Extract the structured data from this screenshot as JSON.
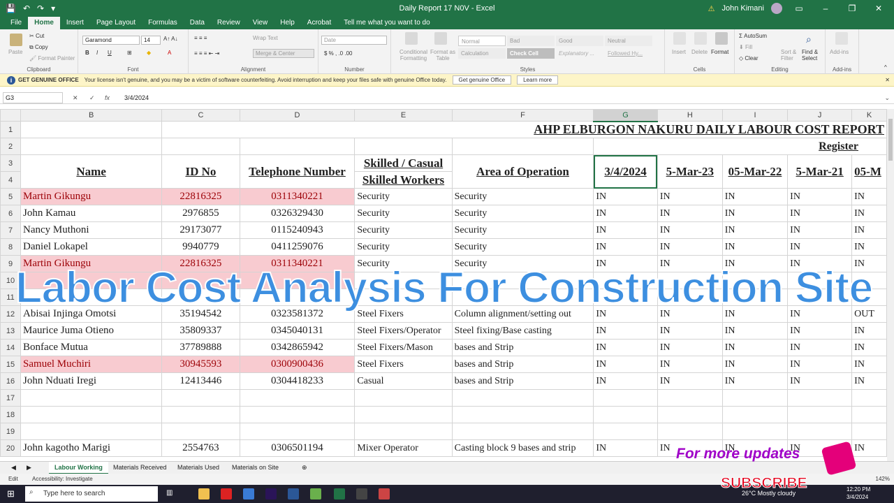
{
  "titlebar": {
    "title": "Daily Report 17 N0V  -  Excel",
    "user": "John Kimani",
    "autosave_icon": "save-icon",
    "warning_icon": "warning-icon"
  },
  "tabs": [
    "File",
    "Home",
    "Insert",
    "Page Layout",
    "Formulas",
    "Data",
    "Review",
    "View",
    "Help",
    "Acrobat",
    "Tell me what you want to do"
  ],
  "active_tab": "Home",
  "ribbon": {
    "clipboard": {
      "label": "Clipboard",
      "paste": "Paste",
      "cut": "Cut",
      "copy": "Copy",
      "format_painter": "Format Painter"
    },
    "font": {
      "label": "Font",
      "family": "Garamond",
      "size": "14",
      "bold": "B",
      "italic": "I",
      "underline": "U"
    },
    "alignment": {
      "label": "Alignment",
      "wrap": "Wrap Text",
      "merge": "Merge & Center"
    },
    "number": {
      "label": "Number",
      "format": "Date"
    },
    "styles": {
      "label": "Styles",
      "conditional": "Conditional Formatting",
      "format_table": "Format as Table",
      "cells": [
        "Normal",
        "Bad",
        "Good",
        "Neutral",
        "Calculation",
        "Check Cell",
        "Explanatory ...",
        "Followed Hy..."
      ]
    },
    "cells": {
      "label": "Cells",
      "insert": "Insert",
      "delete": "Delete",
      "format": "Format"
    },
    "editing": {
      "label": "Editing",
      "autosum": "AutoSum",
      "fill": "Fill",
      "clear": "Clear",
      "sort": "Sort & Filter",
      "find": "Find & Select"
    },
    "addins": {
      "label": "Add-ins",
      "addins": "Add-ins"
    }
  },
  "notice": {
    "title": "GET GENUINE OFFICE",
    "text": "Your license isn't genuine, and you may be a victim of software counterfeiting. Avoid interruption and keep your files safe with genuine Office today.",
    "button1": "Get genuine Office",
    "button2": "Learn more"
  },
  "formula_bar": {
    "cell": "G3",
    "cancel": "✕",
    "enter": "✓",
    "fx": "fx",
    "value": "3/4/2024"
  },
  "columns": [
    "B",
    "C",
    "D",
    "E",
    "F",
    "G",
    "H",
    "I",
    "J",
    "K"
  ],
  "row_numbers": [
    "1",
    "2",
    "3",
    "4",
    "5",
    "6",
    "7",
    "8",
    "9",
    "10",
    "11",
    "12",
    "13",
    "14",
    "15",
    "16",
    "17",
    "18",
    "19",
    "20"
  ],
  "sheet": {
    "title": "AHP ELBURGON NAKURU DAILY LABOUR COST REPORT",
    "register": "Register",
    "headers": {
      "name": "Name",
      "id": "ID No",
      "phone": "Telephone Number",
      "skill1": "Skilled / Casual",
      "skill2": "Skilled Workers",
      "area": "Area of Operation",
      "d1": "3/4/2024",
      "d2": "5-Mar-23",
      "d3": "05-Mar-22",
      "d4": "5-Mar-21",
      "d5": "05-M"
    },
    "rows": [
      {
        "n": "5",
        "name": "Martin Gikungu",
        "id": "22816325",
        "phone": "0311340221",
        "skill": "Security",
        "area": "Security",
        "g": "IN",
        "h": "IN",
        "i": "IN",
        "j": "IN",
        "k": "IN",
        "pink": true
      },
      {
        "n": "6",
        "name": "John Kamau",
        "id": "2976855",
        "phone": "0326329430",
        "skill": "Security",
        "area": "Security",
        "g": "IN",
        "h": "IN",
        "i": "IN",
        "j": "IN",
        "k": "IN",
        "pink": false
      },
      {
        "n": "7",
        "name": "Nancy Muthoni",
        "id": "29173077",
        "phone": "0115240943",
        "skill": "Security",
        "area": "Security",
        "g": "IN",
        "h": "IN",
        "i": "IN",
        "j": "IN",
        "k": "IN",
        "pink": false
      },
      {
        "n": "8",
        "name": "Daniel Lokapel",
        "id": "9940779",
        "phone": "0411259076",
        "skill": "Security",
        "area": "Security",
        "g": "IN",
        "h": "IN",
        "i": "IN",
        "j": "IN",
        "k": "IN",
        "pink": false
      },
      {
        "n": "9",
        "name": "Martin Gikungu",
        "id": "22816325",
        "phone": "0311340221",
        "skill": "Security",
        "area": "Security",
        "g": "IN",
        "h": "IN",
        "i": "IN",
        "j": "IN",
        "k": "IN",
        "pink": true
      },
      {
        "n": "10",
        "name": "",
        "id": "",
        "phone": "",
        "skill": "",
        "area": "",
        "g": "",
        "h": "",
        "i": "",
        "j": "",
        "k": "",
        "pink": true
      },
      {
        "n": "11",
        "name": "",
        "id": "",
        "phone": "",
        "skill": "",
        "area": "",
        "g": "",
        "h": "",
        "i": "",
        "j": "",
        "k": "",
        "pink": false
      },
      {
        "n": "12",
        "name": "Abisai Injinga Omotsi",
        "id": "35194542",
        "phone": "0323581372",
        "skill": "Steel Fixers",
        "area": "Column alignment/setting out",
        "g": "IN",
        "h": "IN",
        "i": "IN",
        "j": "IN",
        "k": "OUT",
        "pink": false
      },
      {
        "n": "13",
        "name": "Maurice Juma Otieno",
        "id": "35809337",
        "phone": "0345040131",
        "skill": "Steel Fixers/Operator",
        "area": "Steel fixing/Base casting",
        "g": "IN",
        "h": "IN",
        "i": "IN",
        "j": "IN",
        "k": "IN",
        "pink": false
      },
      {
        "n": "14",
        "name": "Bonface Mutua",
        "id": "37789888",
        "phone": "0342865942",
        "skill": "Steel Fixers/Mason",
        "area": "bases and Strip",
        "g": "IN",
        "h": "IN",
        "i": "IN",
        "j": "IN",
        "k": "IN",
        "pink": false
      },
      {
        "n": "15",
        "name": "Samuel Muchiri",
        "id": "30945593",
        "phone": "0300900436",
        "skill": "Steel Fixers",
        "area": "bases and Strip",
        "g": "IN",
        "h": "IN",
        "i": "IN",
        "j": "IN",
        "k": "IN",
        "pink": true
      },
      {
        "n": "16",
        "name": "John Nduati Iregi",
        "id": "12413446",
        "phone": "0304418233",
        "skill": "Casual",
        "area": "bases and Strip",
        "g": "IN",
        "h": "IN",
        "i": "IN",
        "j": "IN",
        "k": "IN",
        "pink": false
      },
      {
        "n": "17",
        "name": "",
        "id": "",
        "phone": "",
        "skill": "",
        "area": "",
        "g": "",
        "h": "",
        "i": "",
        "j": "",
        "k": "",
        "pink": false
      },
      {
        "n": "18",
        "name": "",
        "id": "",
        "phone": "",
        "skill": "",
        "area": "",
        "g": "",
        "h": "",
        "i": "",
        "j": "",
        "k": "",
        "pink": false
      },
      {
        "n": "19",
        "name": "",
        "id": "",
        "phone": "",
        "skill": "",
        "area": "",
        "g": "",
        "h": "",
        "i": "",
        "j": "",
        "k": "",
        "pink": false
      },
      {
        "n": "20",
        "name": "John kagotho Marigi",
        "id": "2554763",
        "phone": "0306501194",
        "skill": "Mixer Operator",
        "area": "Casting block 9 bases and strip",
        "g": "IN",
        "h": "IN",
        "i": "IN",
        "j": "IN",
        "k": "IN",
        "pink": false
      }
    ]
  },
  "overlay_title": "Labor Cost Analysis For Construction Site",
  "sheet_tabs": [
    "Labour Working",
    "Materials Received",
    "Materials Used",
    "Materials on Site"
  ],
  "active_sheet": "Labour Working",
  "status": {
    "mode": "Edit",
    "accessibility": "Accessibility: Investigate",
    "zoom": "142%"
  },
  "taskbar": {
    "search": "Type here to search",
    "weather": "26°C  Mostly cloudy",
    "time": "12:20 PM",
    "date": "3/4/2024"
  },
  "promo": {
    "updates": "For more updates",
    "subscribe": "SUBSCRIBE"
  }
}
